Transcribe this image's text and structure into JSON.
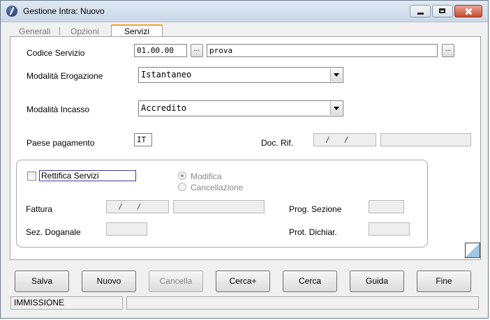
{
  "window": {
    "title": "Gestione Intra: Nuovo"
  },
  "tabs": [
    {
      "label": "Generali"
    },
    {
      "label": "Opzioni"
    },
    {
      "label": "Servizi"
    }
  ],
  "form": {
    "codice_servizio_label": "Codice Servizio",
    "codice_servizio_value": "01.00.00",
    "codice_descr_value": "prova",
    "dots_label": "...",
    "erogazione_label": "Modalità Erogazione",
    "erogazione_value": "Istantaneo",
    "incasso_label": "Modalità Incasso",
    "incasso_value": "Accredito",
    "paese_label": "Paese pagamento",
    "paese_value": "IT",
    "docrif_label": "Doc. Rif.",
    "docrif_date": "  /   /",
    "docrif_extra": ""
  },
  "rettifica": {
    "checkbox_label": "Rettifica Servizi",
    "modifica_label": "Modifica",
    "cancellazione_label": "Cancellazione",
    "fattura_label": "Fattura",
    "fattura_date": "  /   /",
    "fattura_extra": "",
    "prog_label": "Prog. Sezione",
    "prog_value": "",
    "sez_label": "Sez. Doganale",
    "sez_value": "",
    "prot_label": "Prot. Dichiar.",
    "prot_value": ""
  },
  "buttons": {
    "salva": "Salva",
    "nuovo": "Nuovo",
    "cancella": "Cancella",
    "cerca_plus": "Cerca+",
    "cerca": "Cerca",
    "guida": "Guida",
    "fine": "Fine"
  },
  "status": {
    "mode": "IMMISSIONE",
    "message": ""
  }
}
